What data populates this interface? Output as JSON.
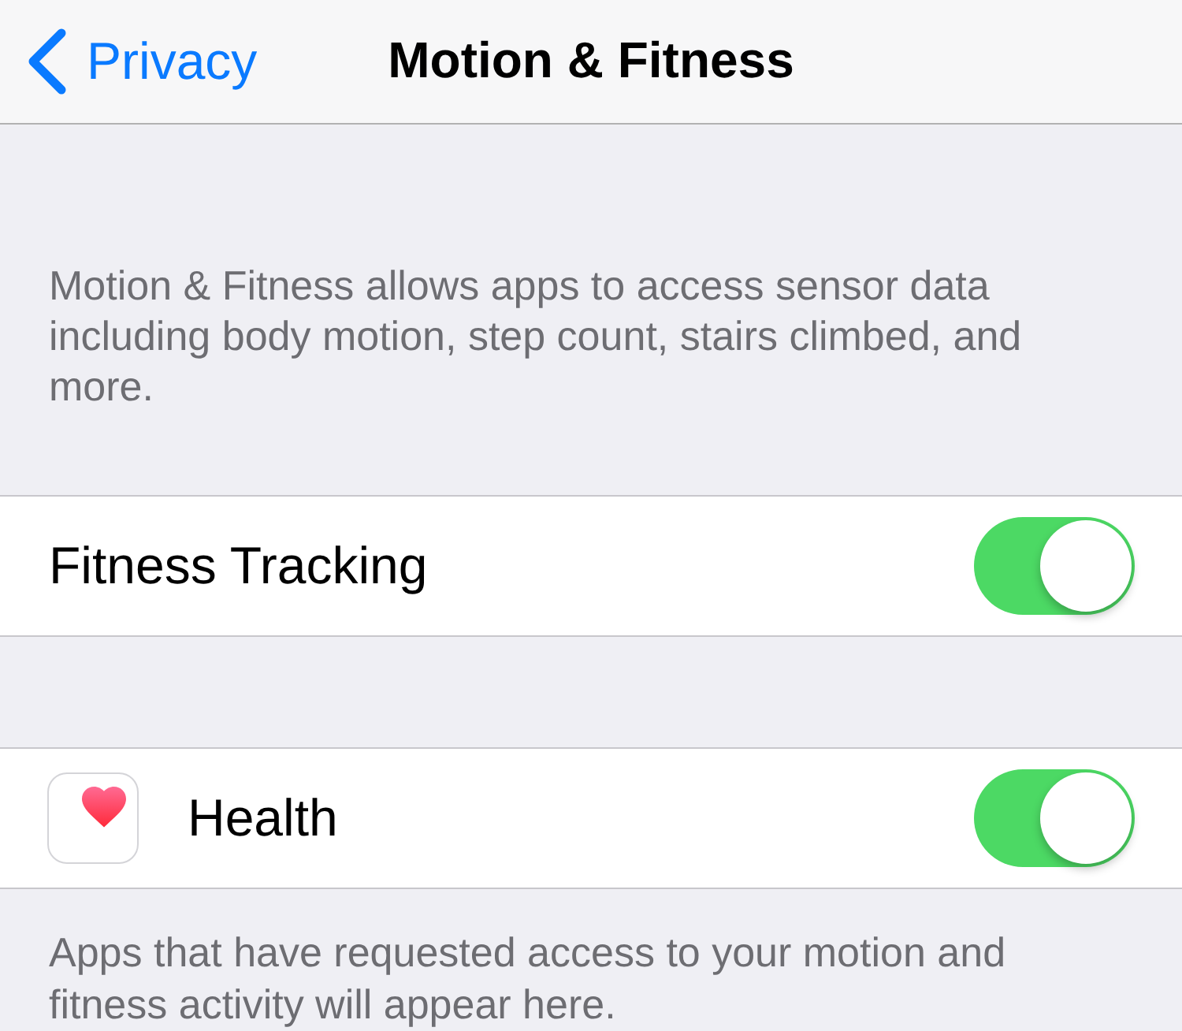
{
  "nav_bar": {
    "back_label": "Privacy",
    "title": "Motion & Fitness"
  },
  "sections": [
    {
      "header": "Motion & Fitness allows apps to access sensor data including body motion, step count, stairs climbed, and more.",
      "rows": [
        {
          "kind": "toggle",
          "label": "Fitness Tracking",
          "on": true
        }
      ]
    },
    {
      "rows": [
        {
          "kind": "app",
          "label": "Health",
          "on": true
        }
      ],
      "footer": "Apps that have requested access to your motion and fitness activity will appear here."
    }
  ]
}
